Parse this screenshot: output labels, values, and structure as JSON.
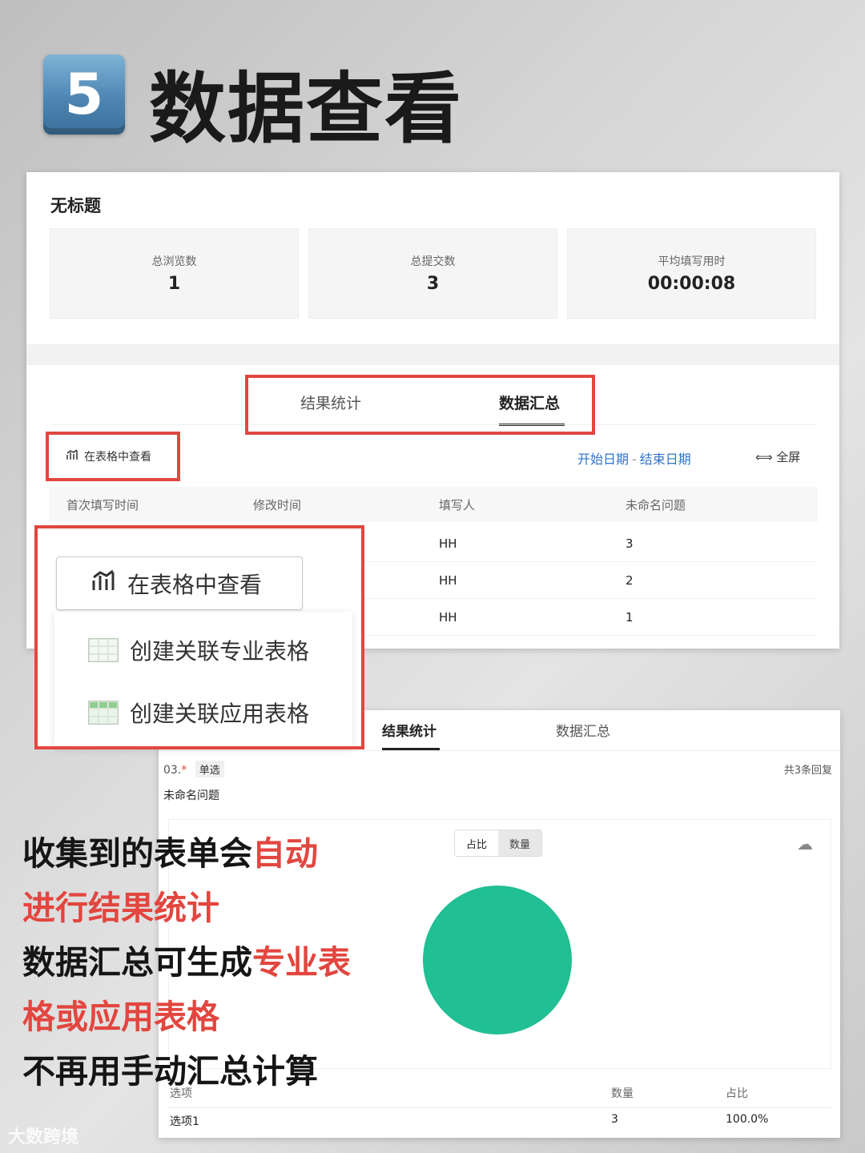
{
  "header": {
    "badge_number": "5",
    "title": "数据查看"
  },
  "panel1": {
    "form_title": "无标题",
    "stats": [
      {
        "label": "总浏览数",
        "value": "1"
      },
      {
        "label": "总提交数",
        "value": "3"
      },
      {
        "label": "平均填写用时",
        "value": "00:00:08"
      }
    ],
    "tabs": [
      {
        "label": "结果统计"
      },
      {
        "label": "数据汇总",
        "active": true
      }
    ],
    "view_in_table_label": "在表格中查看",
    "date_start": "开始日期",
    "date_sep": "-",
    "date_end": "结束日期",
    "fullscreen_label": "全屏",
    "table": {
      "columns": [
        "首次填写时间",
        "修改时间",
        "填写人",
        "未命名问题"
      ],
      "rows": [
        {
          "filler": "HH",
          "answer": "3"
        },
        {
          "filler": "HH",
          "answer": "2"
        },
        {
          "filler": "HH",
          "answer": "1"
        }
      ]
    }
  },
  "dropdown": {
    "button_label": "在表格中查看",
    "items": [
      {
        "label": "创建关联专业表格",
        "icon": "spreadsheet-icon"
      },
      {
        "label": "创建关联应用表格",
        "icon": "app-sheet-icon"
      }
    ]
  },
  "panel2": {
    "tabs": [
      {
        "label": "结果统计",
        "active": true
      },
      {
        "label": "数据汇总"
      }
    ],
    "question_number": "03.",
    "required_mark": "*",
    "question_type": "单选",
    "replies": "共3条回复",
    "question_title": "未命名问题",
    "toggle": {
      "percent_label": "占比",
      "count_label": "数量"
    },
    "table": {
      "columns": [
        "选项",
        "数量",
        "占比"
      ],
      "rows": [
        {
          "option": "选项1",
          "count": "3",
          "ratio": "100.0%"
        }
      ]
    }
  },
  "chart_data": {
    "type": "pie",
    "categories": [
      "选项1"
    ],
    "values": [
      3
    ],
    "colors": [
      "#21bf94"
    ]
  },
  "caption": {
    "line1_a": "收集到的表单会",
    "line1_b": "自动",
    "line2": "进行结果统计",
    "line3_a": "数据汇总可生成",
    "line3_b": "专业表",
    "line4": "格或应用表格",
    "line5": "不再用手动汇总计算"
  },
  "watermark": "大数跨境",
  "colors": {
    "highlight": "#e2463f",
    "link_blue": "#2f74c9",
    "pie_green": "#21bf94"
  }
}
